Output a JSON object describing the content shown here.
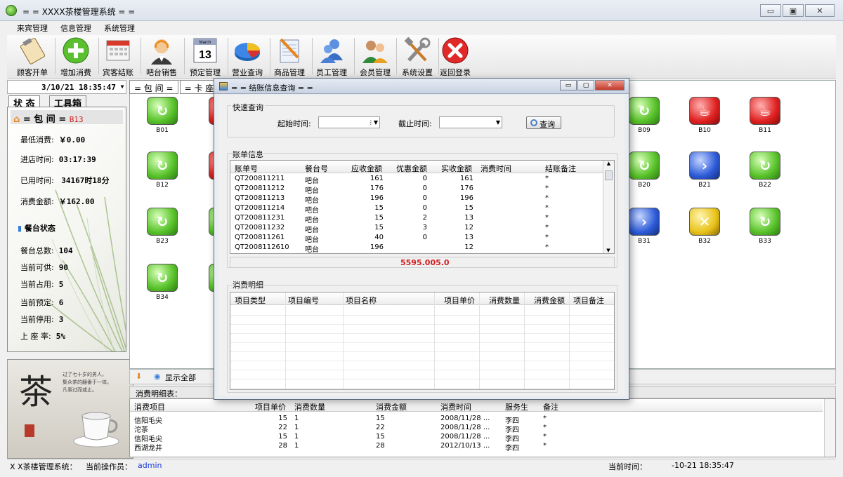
{
  "window": {
    "title": "= = XXXX茶楼管理系统 = ="
  },
  "menu": [
    "来宾管理",
    "信息管理",
    "系统管理"
  ],
  "toolbar": [
    {
      "label": "顾客开单",
      "icon": "clipboard-icon"
    },
    {
      "label": "增加消费",
      "icon": "plus-icon"
    },
    {
      "label": "宾客结账",
      "icon": "calculator-icon"
    },
    {
      "label": "吧台销售",
      "icon": "headset-user-icon"
    },
    {
      "label": "预定管理",
      "icon": "calendar-icon"
    },
    {
      "label": "营业查询",
      "icon": "pie-chart-icon"
    },
    {
      "label": "商品管理",
      "icon": "notepad-icon"
    },
    {
      "label": "员工管理",
      "icon": "users-icon"
    },
    {
      "label": "会员管理",
      "icon": "members-icon"
    },
    {
      "label": "系统设置",
      "icon": "tools-icon"
    },
    {
      "label": "返回登录",
      "icon": "close-red-icon"
    }
  ],
  "calendar_month": "March",
  "calendar_day": "13",
  "left": {
    "datetime": "3/10/21 18:35:47",
    "tabs": [
      "状 态",
      "工具箱"
    ],
    "room_label": "= 包 间 =",
    "room_code": "B13",
    "rows": [
      {
        "label": "最低消费:",
        "value": "￥0.00"
      },
      {
        "label": "进店时间:",
        "value": "03:17:39"
      },
      {
        "label": "已用时间:",
        "value": "34167时18分"
      },
      {
        "label": "消费金额:",
        "value": "￥162.00"
      }
    ],
    "section": "餐台状态",
    "stats": [
      {
        "label": "餐台总数:",
        "value": "104"
      },
      {
        "label": "当前可供:",
        "value": "90"
      },
      {
        "label": "当前占用:",
        "value": "5"
      },
      {
        "label": "当前预定:",
        "value": "6"
      },
      {
        "label": "当前停用:",
        "value": "3"
      },
      {
        "label": "上 座 率:",
        "value": "5%"
      }
    ],
    "tea_char": "茶",
    "tea_text": [
      "过了七十岁的男人，",
      "集众茶的翻番于一体。",
      "凡事过而或止。"
    ]
  },
  "main": {
    "tabs": [
      "= 包 间 =",
      "= 卡 座 ="
    ],
    "tables": [
      {
        "code": "B01",
        "state": "g"
      },
      {
        "code": "B09",
        "state": "g"
      },
      {
        "code": "B10",
        "state": "r"
      },
      {
        "code": "B11",
        "state": "r"
      },
      {
        "code": "B12",
        "state": "g"
      },
      {
        "code": "B20",
        "state": "g"
      },
      {
        "code": "B21",
        "state": "b"
      },
      {
        "code": "B22",
        "state": "g"
      },
      {
        "code": "B23",
        "state": "g"
      },
      {
        "code": "B31",
        "state": "b"
      },
      {
        "code": "B32",
        "state": "y"
      },
      {
        "code": "B33",
        "state": "g"
      },
      {
        "code": "B34",
        "state": "g"
      }
    ],
    "show_all": "显示全部"
  },
  "bottom": {
    "label": "消费明细表：",
    "headers": [
      "消费项目",
      "项目单价",
      "消费数量",
      "消费金额",
      "消费时间",
      "服务生",
      "备注"
    ],
    "rows": [
      [
        "信阳毛尖",
        "15",
        "1",
        "15",
        "2008/11/28 ...",
        "李四",
        "*"
      ],
      [
        "沱茶",
        "22",
        "1",
        "22",
        "2008/11/28 ...",
        "李四",
        "*"
      ],
      [
        "信阳毛尖",
        "15",
        "1",
        "15",
        "2008/11/28 ...",
        "李四",
        "*"
      ],
      [
        "西湖龙井",
        "28",
        "1",
        "28",
        "2012/10/13 ...",
        "李四",
        "*"
      ]
    ]
  },
  "status": {
    "system": "X X茶楼管理系统：",
    "operator_label": "当前操作员：",
    "operator": "admin",
    "time_label": "当前时间：",
    "time": "-10-21 18:35:47"
  },
  "dialog": {
    "title": "= = 结账信息查询 = =",
    "quick": "快速查询",
    "start_label": "起始时间:",
    "end_label": "截止时间:",
    "query": "查询",
    "bill_title": "账单信息",
    "bill_headers": [
      "账单号",
      "餐台号",
      "应收金额",
      "优惠金额",
      "实收金额",
      "消费时间",
      "结账备注"
    ],
    "bills": [
      [
        "QT200811211",
        "吧台",
        "161",
        "0",
        "161",
        "",
        "*"
      ],
      [
        "QT200811212",
        "吧台",
        "176",
        "0",
        "176",
        "",
        "*"
      ],
      [
        "QT200811213",
        "吧台",
        "196",
        "0",
        "196",
        "",
        "*"
      ],
      [
        "QT200811214",
        "吧台",
        "15",
        "0",
        "15",
        "",
        "*"
      ],
      [
        "QT200811231",
        "吧台",
        "15",
        "2",
        "13",
        "",
        "*"
      ],
      [
        "QT200811232",
        "吧台",
        "15",
        "3",
        "12",
        "",
        "*"
      ],
      [
        "QT200811261",
        "吧台",
        "40",
        "0",
        "13",
        "",
        "*"
      ],
      [
        "QT2008112610",
        "吧台",
        "196",
        "",
        "12",
        "",
        "*"
      ]
    ],
    "total": "5595.005.0",
    "detail_title": "消费明细",
    "detail_headers": [
      "项目类型",
      "项目编号",
      "项目名称",
      "项目单价",
      "消费数量",
      "消费金额",
      "项目备注"
    ]
  }
}
